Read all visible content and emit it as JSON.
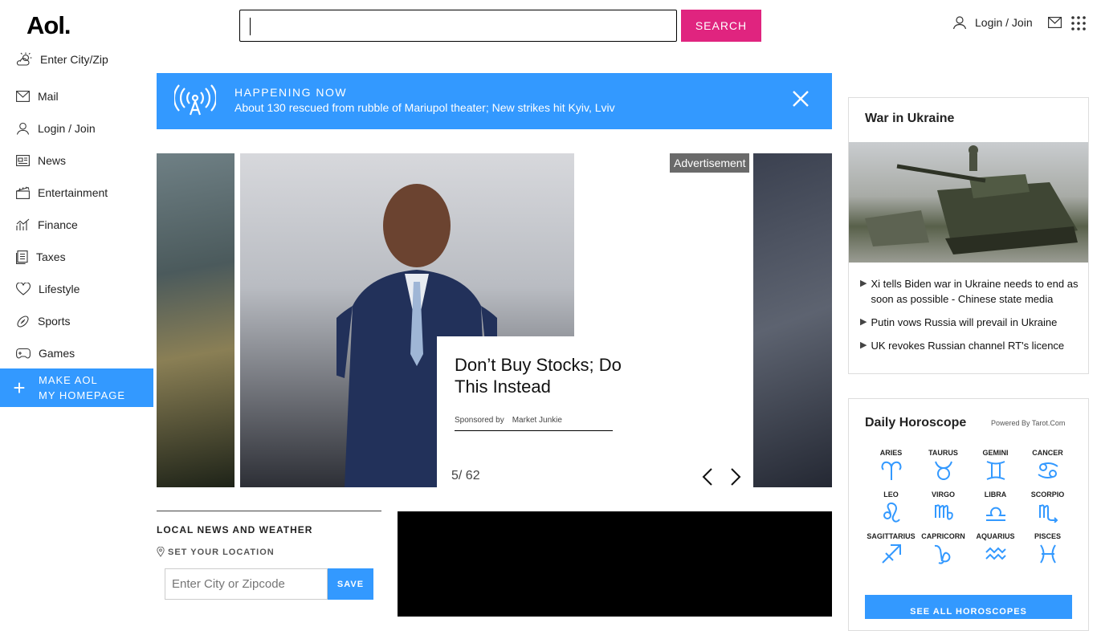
{
  "header": {
    "logo": "Aol.",
    "search_placeholder": "",
    "search_button": "SEARCH",
    "login_label": "Login / Join"
  },
  "sidebar": {
    "items": [
      {
        "label": "Enter City/Zip",
        "icon": "weather-icon"
      },
      {
        "label": "Mail",
        "icon": "mail-icon"
      },
      {
        "label": "Login / Join",
        "icon": "user-icon"
      },
      {
        "label": "News",
        "icon": "news-icon"
      },
      {
        "label": "Entertainment",
        "icon": "clapperboard-icon"
      },
      {
        "label": "Finance",
        "icon": "chart-icon"
      },
      {
        "label": "Taxes",
        "icon": "document-icon"
      },
      {
        "label": "Lifestyle",
        "icon": "heart-icon"
      },
      {
        "label": "Sports",
        "icon": "football-icon"
      },
      {
        "label": "Games",
        "icon": "gamepad-icon"
      }
    ],
    "make_home_line1": "MAKE AOL",
    "make_home_line2": "MY HOMEPAGE"
  },
  "happening": {
    "title": "HAPPENING NOW",
    "text": "About 130 rescued from rubble of Mariupol theater; New strikes hit Kyiv, Lviv"
  },
  "carousel": {
    "ad_label": "Advertisement",
    "caption_title": "Don’t Buy Stocks; Do This Instead",
    "sponsored_by": "Sponsored by",
    "sponsor_name": "Market Junkie",
    "counter": "5/ 62"
  },
  "local": {
    "title": "LOCAL NEWS AND WEATHER",
    "set_location": "SET YOUR LOCATION",
    "input_placeholder": "Enter City or Zipcode",
    "save": "SAVE"
  },
  "ukraine": {
    "title": "War in Ukraine",
    "headlines": [
      "Xi tells Biden war in Ukraine needs to end as soon as possible - Chinese state media",
      "Putin vows Russia will prevail in Ukraine",
      "UK revokes Russian channel RT's licence"
    ]
  },
  "horoscope": {
    "title": "Daily Horoscope",
    "powered_by": "Powered By Tarot.Com",
    "signs": [
      "ARIES",
      "TAURUS",
      "GEMINI",
      "CANCER",
      "LEO",
      "VIRGO",
      "LIBRA",
      "SCORPIO",
      "SAGITTARIUS",
      "CAPRICORN",
      "AQUARIUS",
      "PISCES"
    ],
    "see_all": "SEE ALL HOROSCOPES"
  },
  "colors": {
    "accent_blue": "#3399ff",
    "search_pink": "#e0247f"
  }
}
